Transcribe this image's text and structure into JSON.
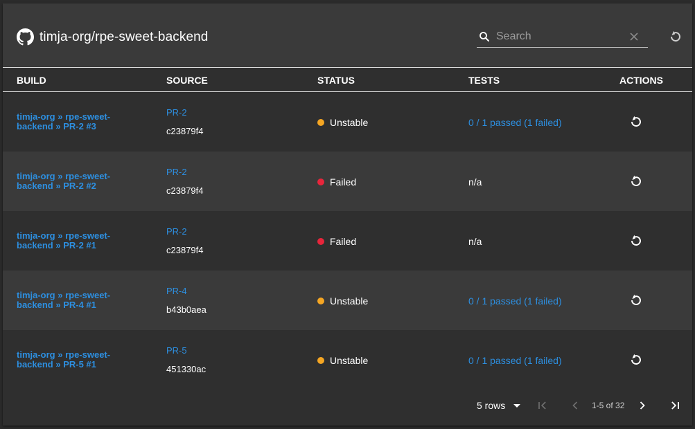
{
  "header": {
    "title": "timja-org/rpe-sweet-backend",
    "search_placeholder": "Search"
  },
  "columns": [
    "BUILD",
    "SOURCE",
    "STATUS",
    "TESTS",
    "ACTIONS"
  ],
  "status_colors": {
    "Unstable": "#f5a623",
    "Failed": "#e8253b"
  },
  "rows": [
    {
      "build": "timja-org » rpe-sweet-backend » PR-2 #3",
      "source_link": "PR-2",
      "source_hash": "c23879f4",
      "status": "Unstable",
      "tests": "0 / 1 passed (1 failed)"
    },
    {
      "build": "timja-org » rpe-sweet-backend » PR-2 #2",
      "source_link": "PR-2",
      "source_hash": "c23879f4",
      "status": "Failed",
      "tests": "n/a"
    },
    {
      "build": "timja-org » rpe-sweet-backend » PR-2 #1",
      "source_link": "PR-2",
      "source_hash": "c23879f4",
      "status": "Failed",
      "tests": "n/a"
    },
    {
      "build": "timja-org » rpe-sweet-backend » PR-4 #1",
      "source_link": "PR-4",
      "source_hash": "b43b0aea",
      "status": "Unstable",
      "tests": "0 / 1 passed (1 failed)"
    },
    {
      "build": "timja-org » rpe-sweet-backend » PR-5 #1",
      "source_link": "PR-5",
      "source_hash": "451330ac",
      "status": "Unstable",
      "tests": "0 / 1 passed (1 failed)"
    }
  ],
  "footer": {
    "rows_per_page": "5 rows",
    "range": "1-5 of 32"
  }
}
